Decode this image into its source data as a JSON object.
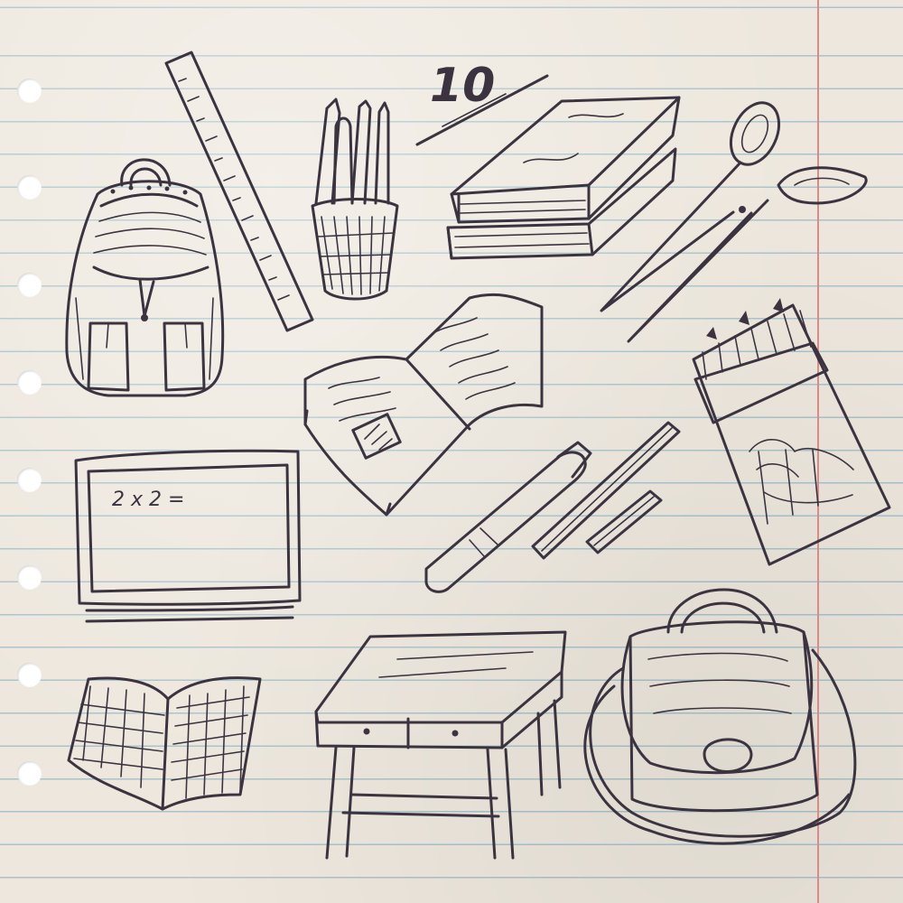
{
  "sheet": {
    "number_sketch": "10",
    "chalkboard_text": "2 x 2 ="
  },
  "icons": [
    "backpack-icon",
    "ruler-icon",
    "pencil-cup-icon",
    "book-stack-icon",
    "scissors-icon",
    "open-book-icon",
    "colored-pencil-box-icon",
    "chalkboard-icon",
    "marker-icon",
    "chalk-icon",
    "notebook-icon",
    "school-desk-icon",
    "school-bag-icon"
  ],
  "colors": {
    "paper": "#ede7dd",
    "ink": "#3b3440",
    "rule_line": "#a9c3cc",
    "margin_line": "#d98b8b",
    "hole": "#ffffff"
  }
}
